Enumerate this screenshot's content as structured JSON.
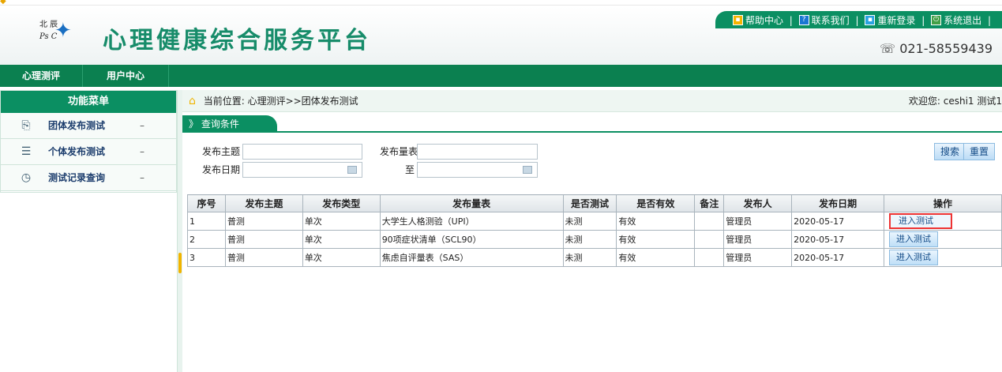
{
  "header": {
    "logo_top": "北 辰",
    "logo_bottom": "Ps   C",
    "site_title": "心理健康综合服务平台",
    "links": [
      {
        "label": "帮助中心",
        "icon": "help-icon"
      },
      {
        "label": "联系我们",
        "icon": "question-icon"
      },
      {
        "label": "重新登录",
        "icon": "relogin-icon"
      },
      {
        "label": "系统退出",
        "icon": "power-icon"
      }
    ],
    "phone": "☏ 021-58559439"
  },
  "nav": {
    "items": [
      "心理测评",
      "用户中心"
    ]
  },
  "sidebar": {
    "title": "功能菜单",
    "items": [
      {
        "label": "团体发布测试",
        "toggle": "–",
        "icon": "document-export-icon"
      },
      {
        "label": "个体发布测试",
        "toggle": "–",
        "icon": "list-icon"
      },
      {
        "label": "测试记录查询",
        "toggle": "–",
        "icon": "clock-icon"
      }
    ]
  },
  "breadcrumb": {
    "text": "当前位置: 心理测评>>团体发布测试",
    "welcome": "欢迎您: ceshi1  测试1"
  },
  "query": {
    "tab_label": "》 查询条件",
    "subject_label": "发布主题",
    "scale_label": "发布量表",
    "date_label": "发布日期",
    "to_label": "至",
    "subject_value": "",
    "scale_value": "",
    "date_from": "",
    "date_to": "",
    "search_button": "搜索",
    "reset_button": "重置"
  },
  "table": {
    "columns": [
      "序号",
      "发布主题",
      "发布类型",
      "发布量表",
      "是否测试",
      "是否有效",
      "备注",
      "发布人",
      "发布日期",
      "操作"
    ],
    "rows": [
      {
        "no": "1",
        "subject": "普测",
        "type": "单次",
        "scale": "大学生人格测验（UPI）",
        "tested": "未测",
        "valid": "有效",
        "remark": "",
        "publisher": "管理员",
        "date": "2020-05-17",
        "action": "进入测试"
      },
      {
        "no": "2",
        "subject": "普测",
        "type": "单次",
        "scale": "90项症状清单（SCL90）",
        "tested": "未测",
        "valid": "有效",
        "remark": "",
        "publisher": "管理员",
        "date": "2020-05-17",
        "action": "进入测试"
      },
      {
        "no": "3",
        "subject": "普测",
        "type": "单次",
        "scale": "焦虑自评量表（SAS）",
        "tested": "未测",
        "valid": "有效",
        "remark": "",
        "publisher": "管理员",
        "date": "2020-05-17",
        "action": "进入测试"
      }
    ]
  }
}
